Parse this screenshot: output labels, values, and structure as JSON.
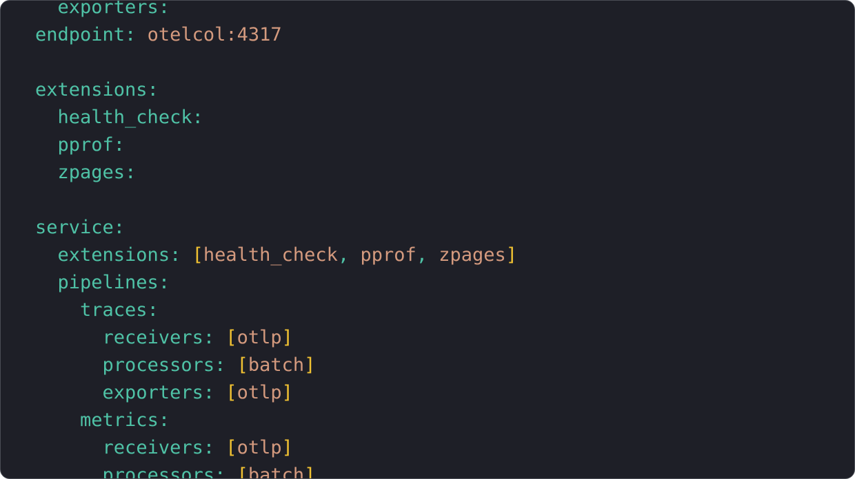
{
  "code_lines": [
    {
      "indent": "  ",
      "key": "exporters",
      "suffix": ":"
    },
    {
      "indent": "",
      "key": "endpoint",
      "suffix": ": ",
      "value": "otelcol:4317"
    },
    {
      "indent": "",
      "key": "",
      "suffix": ""
    },
    {
      "indent": "",
      "key": "extensions",
      "suffix": ":"
    },
    {
      "indent": "  ",
      "key": "health_check",
      "suffix": ":"
    },
    {
      "indent": "  ",
      "key": "pprof",
      "suffix": ":"
    },
    {
      "indent": "  ",
      "key": "zpages",
      "suffix": ":"
    },
    {
      "indent": "",
      "key": "",
      "suffix": ""
    },
    {
      "indent": "",
      "key": "service",
      "suffix": ":"
    },
    {
      "indent": "  ",
      "key": "extensions",
      "suffix": ": ",
      "list": [
        "health_check",
        "pprof",
        "zpages"
      ]
    },
    {
      "indent": "  ",
      "key": "pipelines",
      "suffix": ":"
    },
    {
      "indent": "    ",
      "key": "traces",
      "suffix": ":"
    },
    {
      "indent": "      ",
      "key": "receivers",
      "suffix": ": ",
      "list": [
        "otlp"
      ]
    },
    {
      "indent": "      ",
      "key": "processors",
      "suffix": ": ",
      "list": [
        "batch"
      ]
    },
    {
      "indent": "      ",
      "key": "exporters",
      "suffix": ": ",
      "list": [
        "otlp"
      ]
    },
    {
      "indent": "    ",
      "key": "metrics",
      "suffix": ":"
    },
    {
      "indent": "      ",
      "key": "receivers",
      "suffix": ": ",
      "list": [
        "otlp"
      ]
    },
    {
      "indent": "      ",
      "key": "processors",
      "suffix": ": ",
      "list": [
        "batch"
      ]
    }
  ],
  "colors": {
    "background": "#1e1f27",
    "key": "#4fc2a6",
    "string": "#d49a7e",
    "bracket": "#f1c232"
  }
}
